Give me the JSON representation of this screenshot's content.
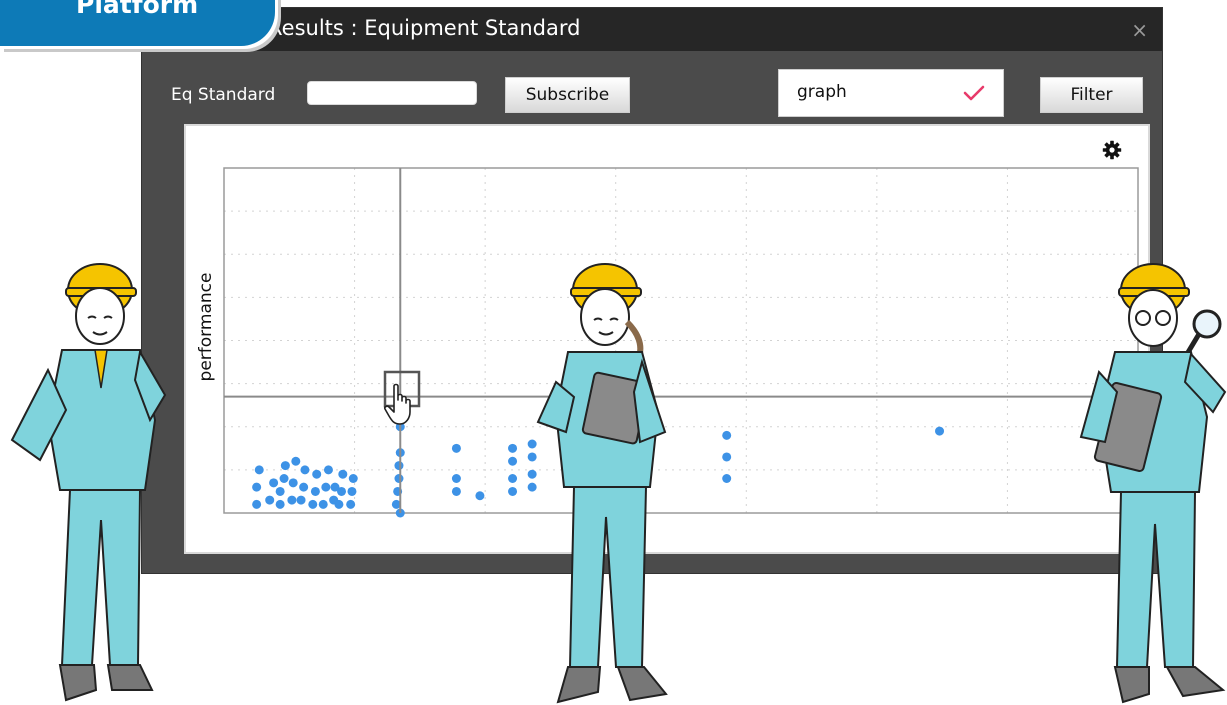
{
  "badge": {
    "label": "Platform"
  },
  "window": {
    "title": "Results : Equipment Standard",
    "close_glyph": "×"
  },
  "toolbar": {
    "eq_label": "Eq Standard",
    "eq_value": "",
    "subscribe_label": "Subscribe",
    "select_value": "graph",
    "filter_label": "Filter"
  },
  "icons": {
    "check": "check-icon",
    "gear": "gear-icon",
    "close": "close-icon",
    "cursor": "hand-pointer-icon"
  },
  "colors": {
    "accent_check": "#e83a6a",
    "points": "#3d92e6",
    "badge": "#0d7ab7",
    "uniform": "#7fd3dc",
    "helmet": "#f5c400"
  },
  "chart_data": {
    "type": "scatter",
    "title": "",
    "xlabel": "",
    "ylabel": "performance",
    "grid": true,
    "xlim": [
      0,
      7
    ],
    "ylim": [
      0,
      8
    ],
    "crosshair": {
      "x": 1.35,
      "y": 2.7
    },
    "points": [
      {
        "x": 0.25,
        "y": 0.2
      },
      {
        "x": 0.25,
        "y": 0.6
      },
      {
        "x": 0.27,
        "y": 1.0
      },
      {
        "x": 0.35,
        "y": 0.3
      },
      {
        "x": 0.38,
        "y": 0.7
      },
      {
        "x": 0.43,
        "y": 0.2
      },
      {
        "x": 0.43,
        "y": 0.5
      },
      {
        "x": 0.46,
        "y": 0.8
      },
      {
        "x": 0.47,
        "y": 1.1
      },
      {
        "x": 0.52,
        "y": 0.3
      },
      {
        "x": 0.53,
        "y": 0.7
      },
      {
        "x": 0.55,
        "y": 1.2
      },
      {
        "x": 0.59,
        "y": 0.3
      },
      {
        "x": 0.61,
        "y": 0.6
      },
      {
        "x": 0.62,
        "y": 1.0
      },
      {
        "x": 0.68,
        "y": 0.2
      },
      {
        "x": 0.7,
        "y": 0.5
      },
      {
        "x": 0.71,
        "y": 0.9
      },
      {
        "x": 0.76,
        "y": 0.2
      },
      {
        "x": 0.78,
        "y": 0.6
      },
      {
        "x": 0.8,
        "y": 1.0
      },
      {
        "x": 0.84,
        "y": 0.3
      },
      {
        "x": 0.85,
        "y": 0.6
      },
      {
        "x": 0.88,
        "y": 0.2
      },
      {
        "x": 0.9,
        "y": 0.5
      },
      {
        "x": 0.91,
        "y": 0.9
      },
      {
        "x": 0.97,
        "y": 0.2
      },
      {
        "x": 0.98,
        "y": 0.5
      },
      {
        "x": 0.99,
        "y": 0.8
      },
      {
        "x": 1.32,
        "y": 0.2
      },
      {
        "x": 1.33,
        "y": 0.5
      },
      {
        "x": 1.34,
        "y": 0.8
      },
      {
        "x": 1.34,
        "y": 1.1
      },
      {
        "x": 1.35,
        "y": 1.4
      },
      {
        "x": 1.35,
        "y": 2.0
      },
      {
        "x": 1.36,
        "y": 2.2
      },
      {
        "x": 1.35,
        "y": 0.0
      },
      {
        "x": 1.78,
        "y": 0.5
      },
      {
        "x": 1.78,
        "y": 0.8
      },
      {
        "x": 1.78,
        "y": 1.5
      },
      {
        "x": 1.96,
        "y": 0.4
      },
      {
        "x": 2.21,
        "y": 0.5
      },
      {
        "x": 2.21,
        "y": 0.8
      },
      {
        "x": 2.21,
        "y": 1.2
      },
      {
        "x": 2.21,
        "y": 1.5
      },
      {
        "x": 2.36,
        "y": 0.6
      },
      {
        "x": 2.36,
        "y": 0.9
      },
      {
        "x": 2.36,
        "y": 1.3
      },
      {
        "x": 2.36,
        "y": 1.6
      },
      {
        "x": 3.85,
        "y": 0.8
      },
      {
        "x": 3.85,
        "y": 1.3
      },
      {
        "x": 3.85,
        "y": 1.8
      },
      {
        "x": 5.48,
        "y": 1.9
      }
    ]
  }
}
